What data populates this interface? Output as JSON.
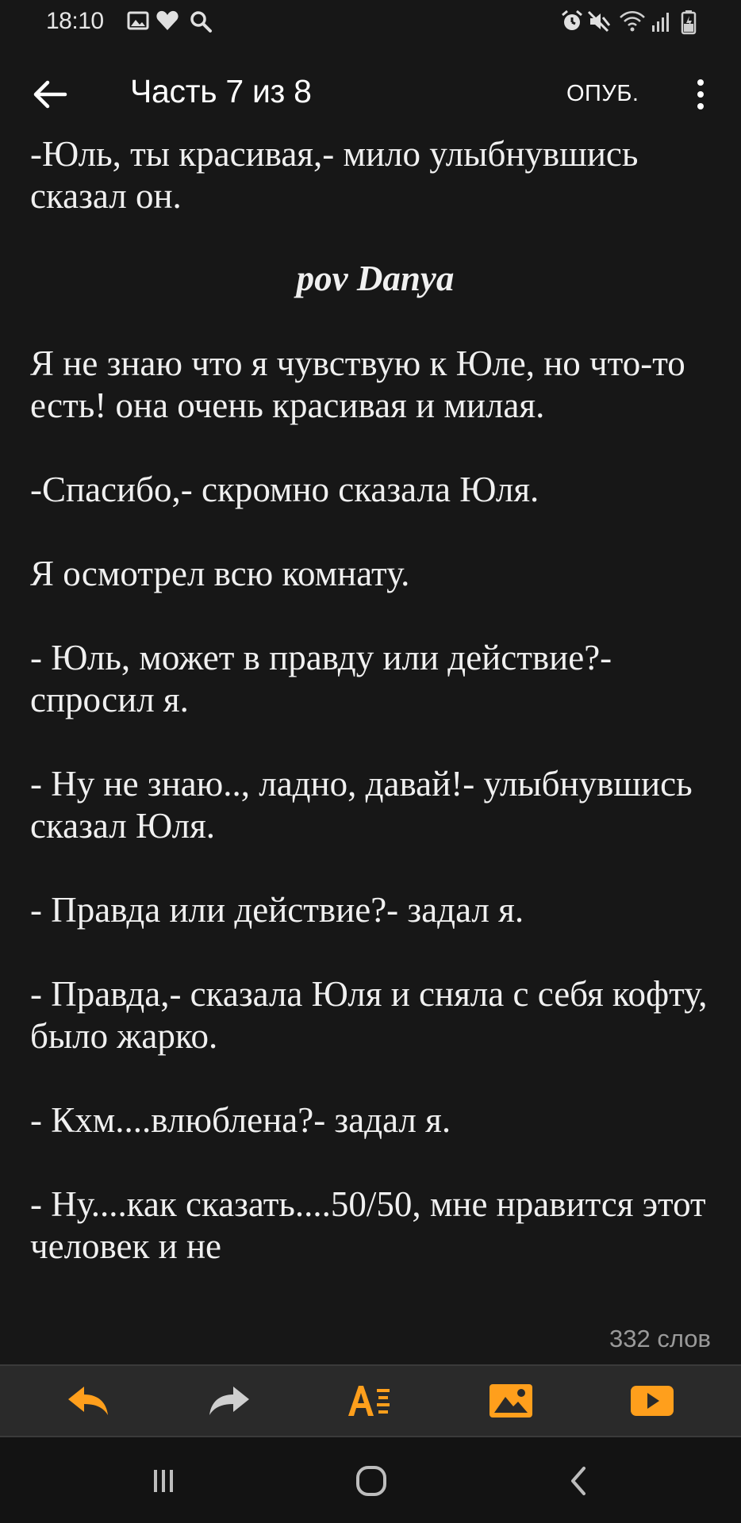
{
  "status_bar": {
    "time": "18:10",
    "left_icons": [
      "gallery-icon",
      "heart-icon",
      "search-icon"
    ],
    "right_icons": [
      "alarm-icon",
      "mute-icon",
      "wifi-icon",
      "signal-icon",
      "battery-icon"
    ]
  },
  "header": {
    "title": "Часть 7 из 8",
    "publish_label": "ОПУБ."
  },
  "story": {
    "paragraphs_before": [
      "-Юль, ты красивая,- мило улыбнувшись сказал он."
    ],
    "pov_heading": "pov Danya",
    "paragraphs_after": [
      "Я не знаю что я чувствую к Юле, но что-то есть! она очень красивая и милая.",
      "-Спасибо,- скромно сказала Юля.",
      "Я осмотрел всю комнату.",
      "- Юль, может в правду или действие?- спросил я.",
      "- Ну не знаю.., ладно, давай!- улыбнувшись сказал Юля.",
      "- Правда или действие?- задал я.",
      "- Правда,- сказала Юля и сняла с себя кофту, было жарко.",
      "- Кхм....влюблена?- задал я.",
      "- Ну....как сказать....50/50, мне нравится этот человек и не"
    ],
    "word_count": "332 слов"
  },
  "toolbar": {
    "accent_color": "#ff9f1c",
    "buttons": [
      "undo-icon",
      "redo-icon",
      "text-format-icon",
      "insert-image-icon",
      "insert-video-icon"
    ]
  },
  "nav_bar": {
    "buttons": [
      "recents-icon",
      "home-icon",
      "back-icon"
    ]
  }
}
